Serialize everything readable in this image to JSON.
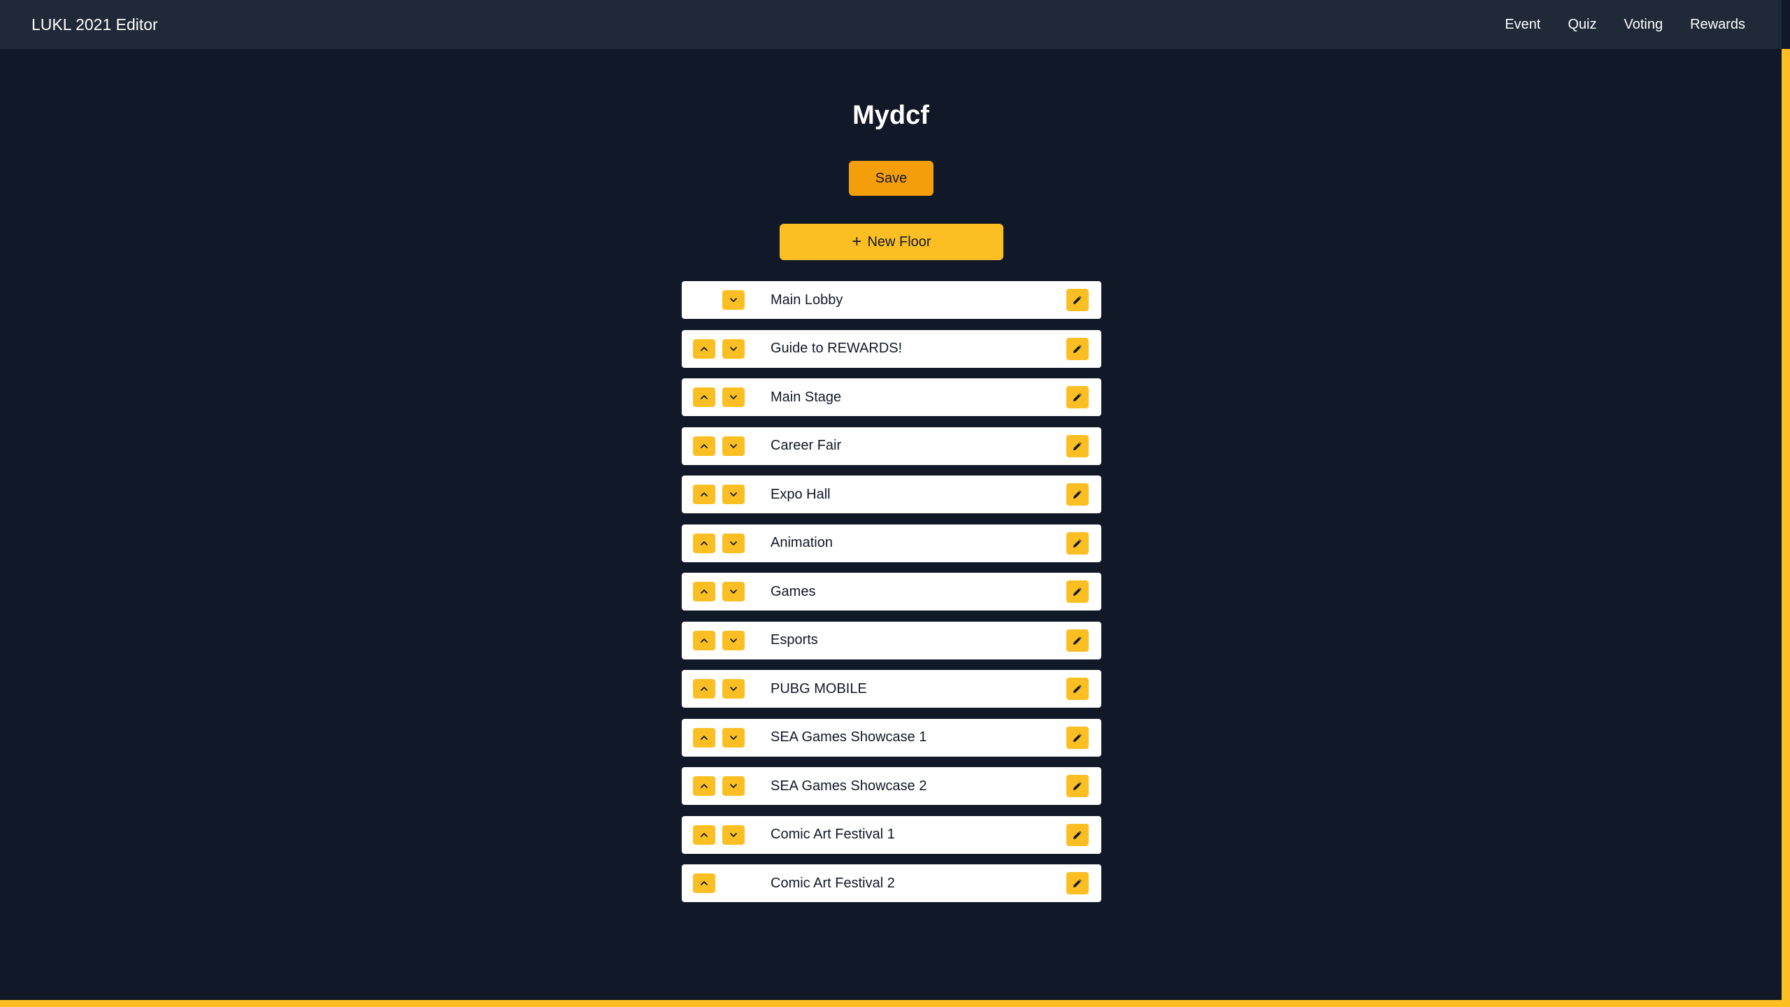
{
  "app": {
    "title": "LUKL 2021 Editor",
    "nav": [
      "Event",
      "Quiz",
      "Voting",
      "Rewards"
    ]
  },
  "page": {
    "title": "Mydcf",
    "save_label": "Save",
    "new_floor_label": "New Floor"
  },
  "colors": {
    "background": "#111827",
    "navbar": "#1f2937",
    "accent": "#fbbf24",
    "save": "#f59e0b"
  },
  "icons": {
    "new_floor": "plus-icon",
    "move_up": "chevron-up-icon",
    "move_down": "chevron-down-icon",
    "edit": "pencil-icon"
  },
  "floors": [
    {
      "name": "Main Lobby",
      "can_move_up": false,
      "can_move_down": true
    },
    {
      "name": "Guide to REWARDS!",
      "can_move_up": true,
      "can_move_down": true
    },
    {
      "name": "Main Stage",
      "can_move_up": true,
      "can_move_down": true
    },
    {
      "name": "Career Fair",
      "can_move_up": true,
      "can_move_down": true
    },
    {
      "name": "Expo Hall",
      "can_move_up": true,
      "can_move_down": true
    },
    {
      "name": "Animation",
      "can_move_up": true,
      "can_move_down": true
    },
    {
      "name": "Games",
      "can_move_up": true,
      "can_move_down": true
    },
    {
      "name": "Esports",
      "can_move_up": true,
      "can_move_down": true
    },
    {
      "name": "PUBG MOBILE",
      "can_move_up": true,
      "can_move_down": true
    },
    {
      "name": "SEA Games Showcase 1",
      "can_move_up": true,
      "can_move_down": true
    },
    {
      "name": "SEA Games Showcase 2",
      "can_move_up": true,
      "can_move_down": true
    },
    {
      "name": "Comic Art Festival 1",
      "can_move_up": true,
      "can_move_down": true
    },
    {
      "name": "Comic Art Festival 2",
      "can_move_up": true,
      "can_move_down": false
    }
  ]
}
